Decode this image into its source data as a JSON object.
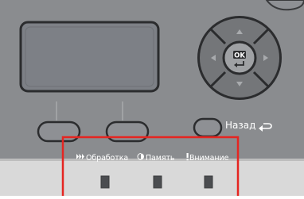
{
  "colors": {
    "panel": "#8a8c8f",
    "panel_dark": "#505254",
    "screen": "#7d8086",
    "button": "#8e9094",
    "button_border": "#3a3b3d",
    "dpad": "#747679",
    "ok_center": "#9fa1a4",
    "lamp": "#4b4d50",
    "callout": "#e52521"
  },
  "buttons": {
    "back_label": "Назад",
    "ok_label": "OK"
  },
  "indicators": [
    {
      "label": "Обработка",
      "icon": "processing-icon"
    },
    {
      "label": "Память",
      "icon": "memory-icon"
    },
    {
      "label": "Внимание",
      "icon": "attention-icon"
    }
  ]
}
